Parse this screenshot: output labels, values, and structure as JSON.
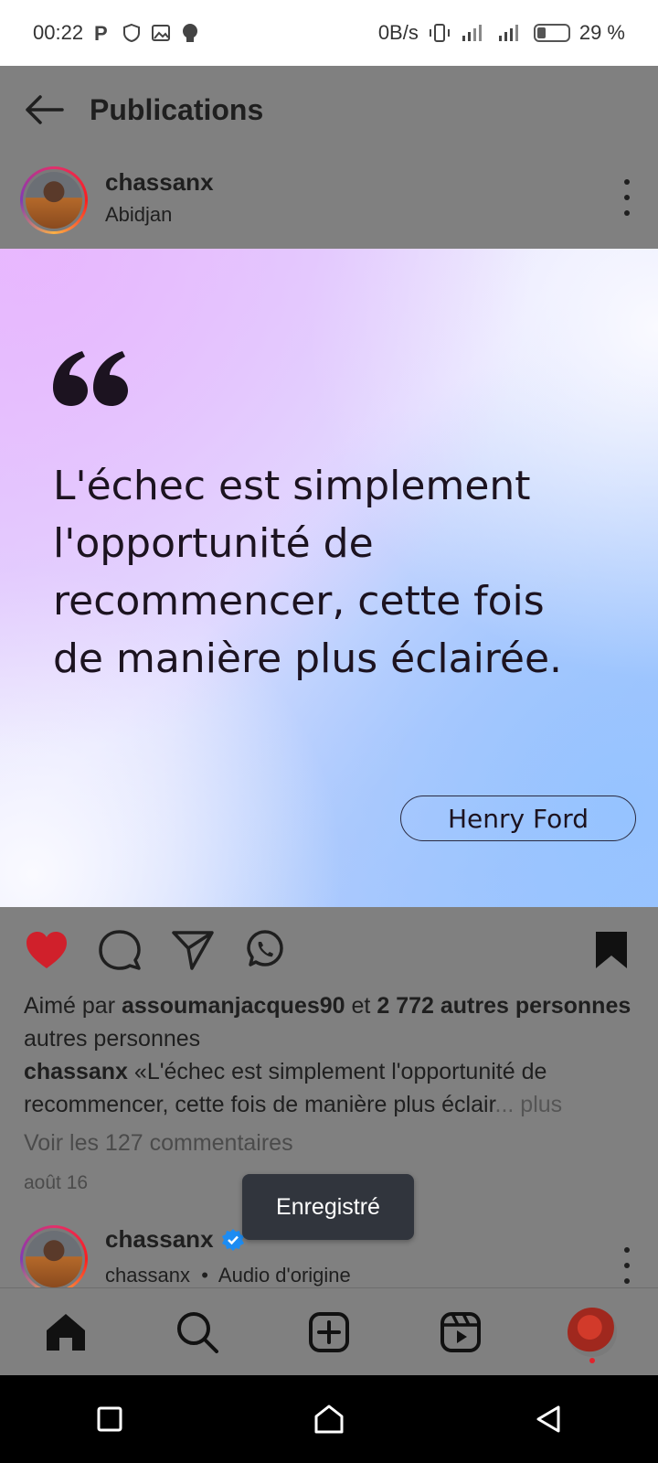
{
  "status_bar": {
    "time": "00:22",
    "net_speed": "0B/s",
    "battery": "29 %",
    "battery_level": 0.29
  },
  "header": {
    "title": "Publications"
  },
  "post": {
    "username": "chassanx",
    "location": "Abidjan",
    "quote": "L'échec est simplement l'opportunité de recommencer, cette fois de manière plus éclairée.",
    "author": "Henry Ford",
    "liked": true,
    "saved": true,
    "likes_prefix": "Aimé par",
    "likes_user": "assoumanjacques90",
    "likes_and": "et",
    "likes_count": "2 772 autres personnes",
    "likes_suffix": "autres personnes",
    "caption_user": "chassanx",
    "caption_text": "«L'échec est simplement l'opportunité de recommencer, cette fois de manière plus éclair",
    "caption_more": "... plus",
    "comments_link": "Voir les 127 commentaires",
    "date": "août 16"
  },
  "toast": {
    "text": "Enregistré"
  },
  "next_post": {
    "username": "chassanx",
    "subtitle_user": "chassanx",
    "subtitle_sep": "•",
    "subtitle_audio": "Audio d'origine",
    "verified": true
  },
  "colors": {
    "like_red": "#d0202b",
    "verified_blue": "#1d8cf2"
  },
  "icons": {
    "bottom_nav": [
      "home-icon",
      "search-icon",
      "create-post-icon",
      "reels-icon",
      "profile-avatar"
    ],
    "system_nav": [
      "recents-icon",
      "home-icon",
      "back-icon"
    ]
  }
}
